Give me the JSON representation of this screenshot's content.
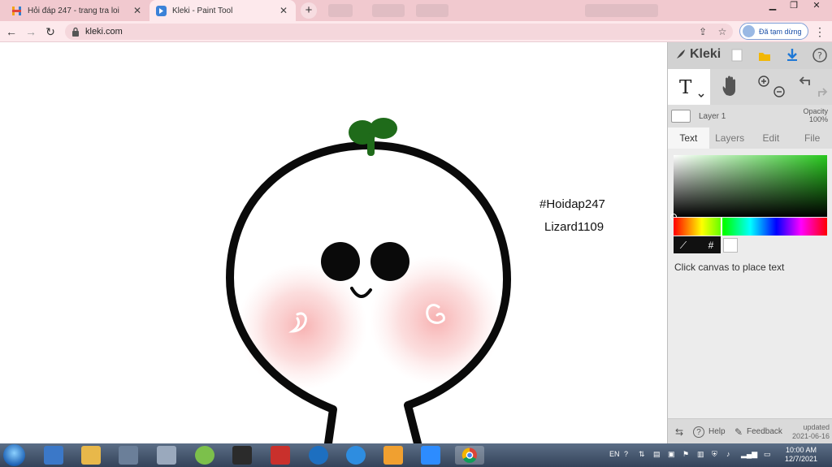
{
  "browser": {
    "tabs": [
      {
        "title": "Hỏi đáp 247 - trang tra loi",
        "active": false
      },
      {
        "title": "Kleki - Paint Tool",
        "active": true
      }
    ],
    "new_tab": "+",
    "address": "kleki.com",
    "profile_status": "Đã tạm dừng",
    "colors": {
      "tabstrip": "#f1c9cf",
      "toolbar": "#fde9ec"
    }
  },
  "canvas": {
    "texts": [
      "#Hoidap247",
      "Lizard1109"
    ]
  },
  "kleki": {
    "brand": "Kleki",
    "layer_name": "Layer 1",
    "opacity_label": "Opacity",
    "opacity_value": "100%",
    "tabs": [
      "Text",
      "Layers",
      "Edit",
      "File"
    ],
    "active_tab": "Text",
    "hex_symbol": "#",
    "hint": "Click canvas to place text",
    "footer": {
      "help": "Help",
      "feedback": "Feedback",
      "updated_label": "updated",
      "updated_date": "2021-06-16"
    },
    "colors": {
      "picked": "#28c81e",
      "swatch": "#ffffff"
    }
  },
  "taskbar": {
    "language": "EN",
    "time": "10:00 AM",
    "date": "12/7/2021"
  }
}
